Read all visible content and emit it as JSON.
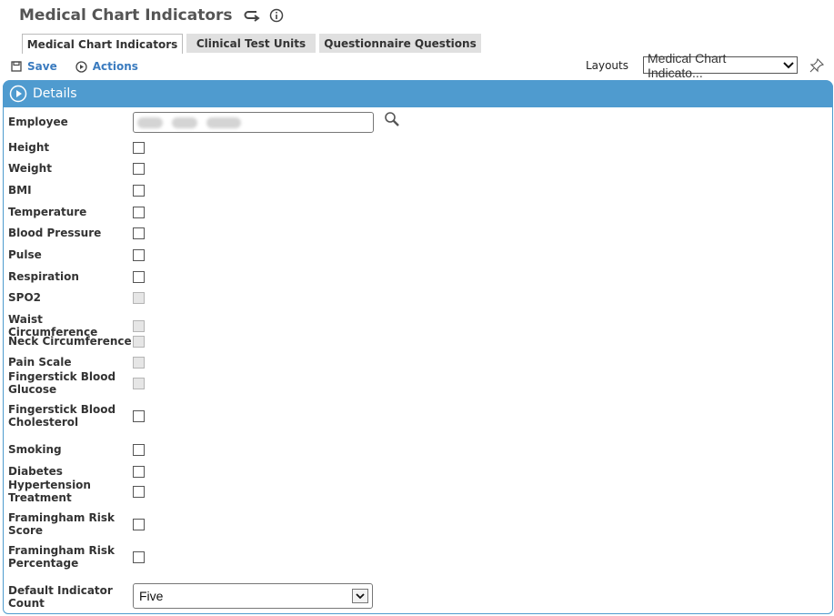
{
  "header": {
    "title": "Medical Chart Indicators",
    "icons": [
      "return-icon",
      "info-icon"
    ]
  },
  "tabs": [
    {
      "label": "Medical Chart Indicators",
      "active": true
    },
    {
      "label": "Clinical Test Units",
      "active": false
    },
    {
      "label": "Questionnaire Questions",
      "active": false
    }
  ],
  "toolbar": {
    "save_label": "Save",
    "actions_label": "Actions"
  },
  "layouts": {
    "label": "Layouts",
    "selected": "Medical Chart Indicato..."
  },
  "panel": {
    "title": "Details"
  },
  "employee": {
    "label": "Employee",
    "value": "(redacted)"
  },
  "indicators": [
    {
      "label": "Height",
      "checked": false,
      "disabled": false
    },
    {
      "label": "Weight",
      "checked": false,
      "disabled": false
    },
    {
      "label": "BMI",
      "checked": false,
      "disabled": false
    },
    {
      "label": "Temperature",
      "checked": false,
      "disabled": false
    },
    {
      "label": "Blood Pressure",
      "checked": false,
      "disabled": false
    },
    {
      "label": "Pulse",
      "checked": false,
      "disabled": false
    },
    {
      "label": "Respiration",
      "checked": false,
      "disabled": false
    },
    {
      "label": "SPO2",
      "checked": false,
      "disabled": true
    },
    {
      "label": "Waist Circumference",
      "checked": false,
      "disabled": true
    },
    {
      "label": "Neck Circumference",
      "checked": false,
      "disabled": true
    },
    {
      "label": "Pain Scale",
      "checked": false,
      "disabled": true
    },
    {
      "label": "Fingerstick Blood Glucose",
      "checked": false,
      "disabled": true
    },
    {
      "label": "Fingerstick Blood Cholesterol",
      "checked": false,
      "disabled": false
    },
    {
      "label": "Smoking",
      "checked": false,
      "disabled": false
    },
    {
      "label": "Diabetes",
      "checked": false,
      "disabled": false
    },
    {
      "label": "Hypertension Treatment",
      "checked": false,
      "disabled": false
    },
    {
      "label": "Framingham Risk Score",
      "checked": false,
      "disabled": false
    },
    {
      "label": "Framingham Risk Percentage",
      "checked": false,
      "disabled": false
    }
  ],
  "default_count": {
    "label": "Default Indicator Count",
    "selected": "Five"
  },
  "colors": {
    "accent": "#4f9bcf",
    "link": "#3a7bbf"
  }
}
